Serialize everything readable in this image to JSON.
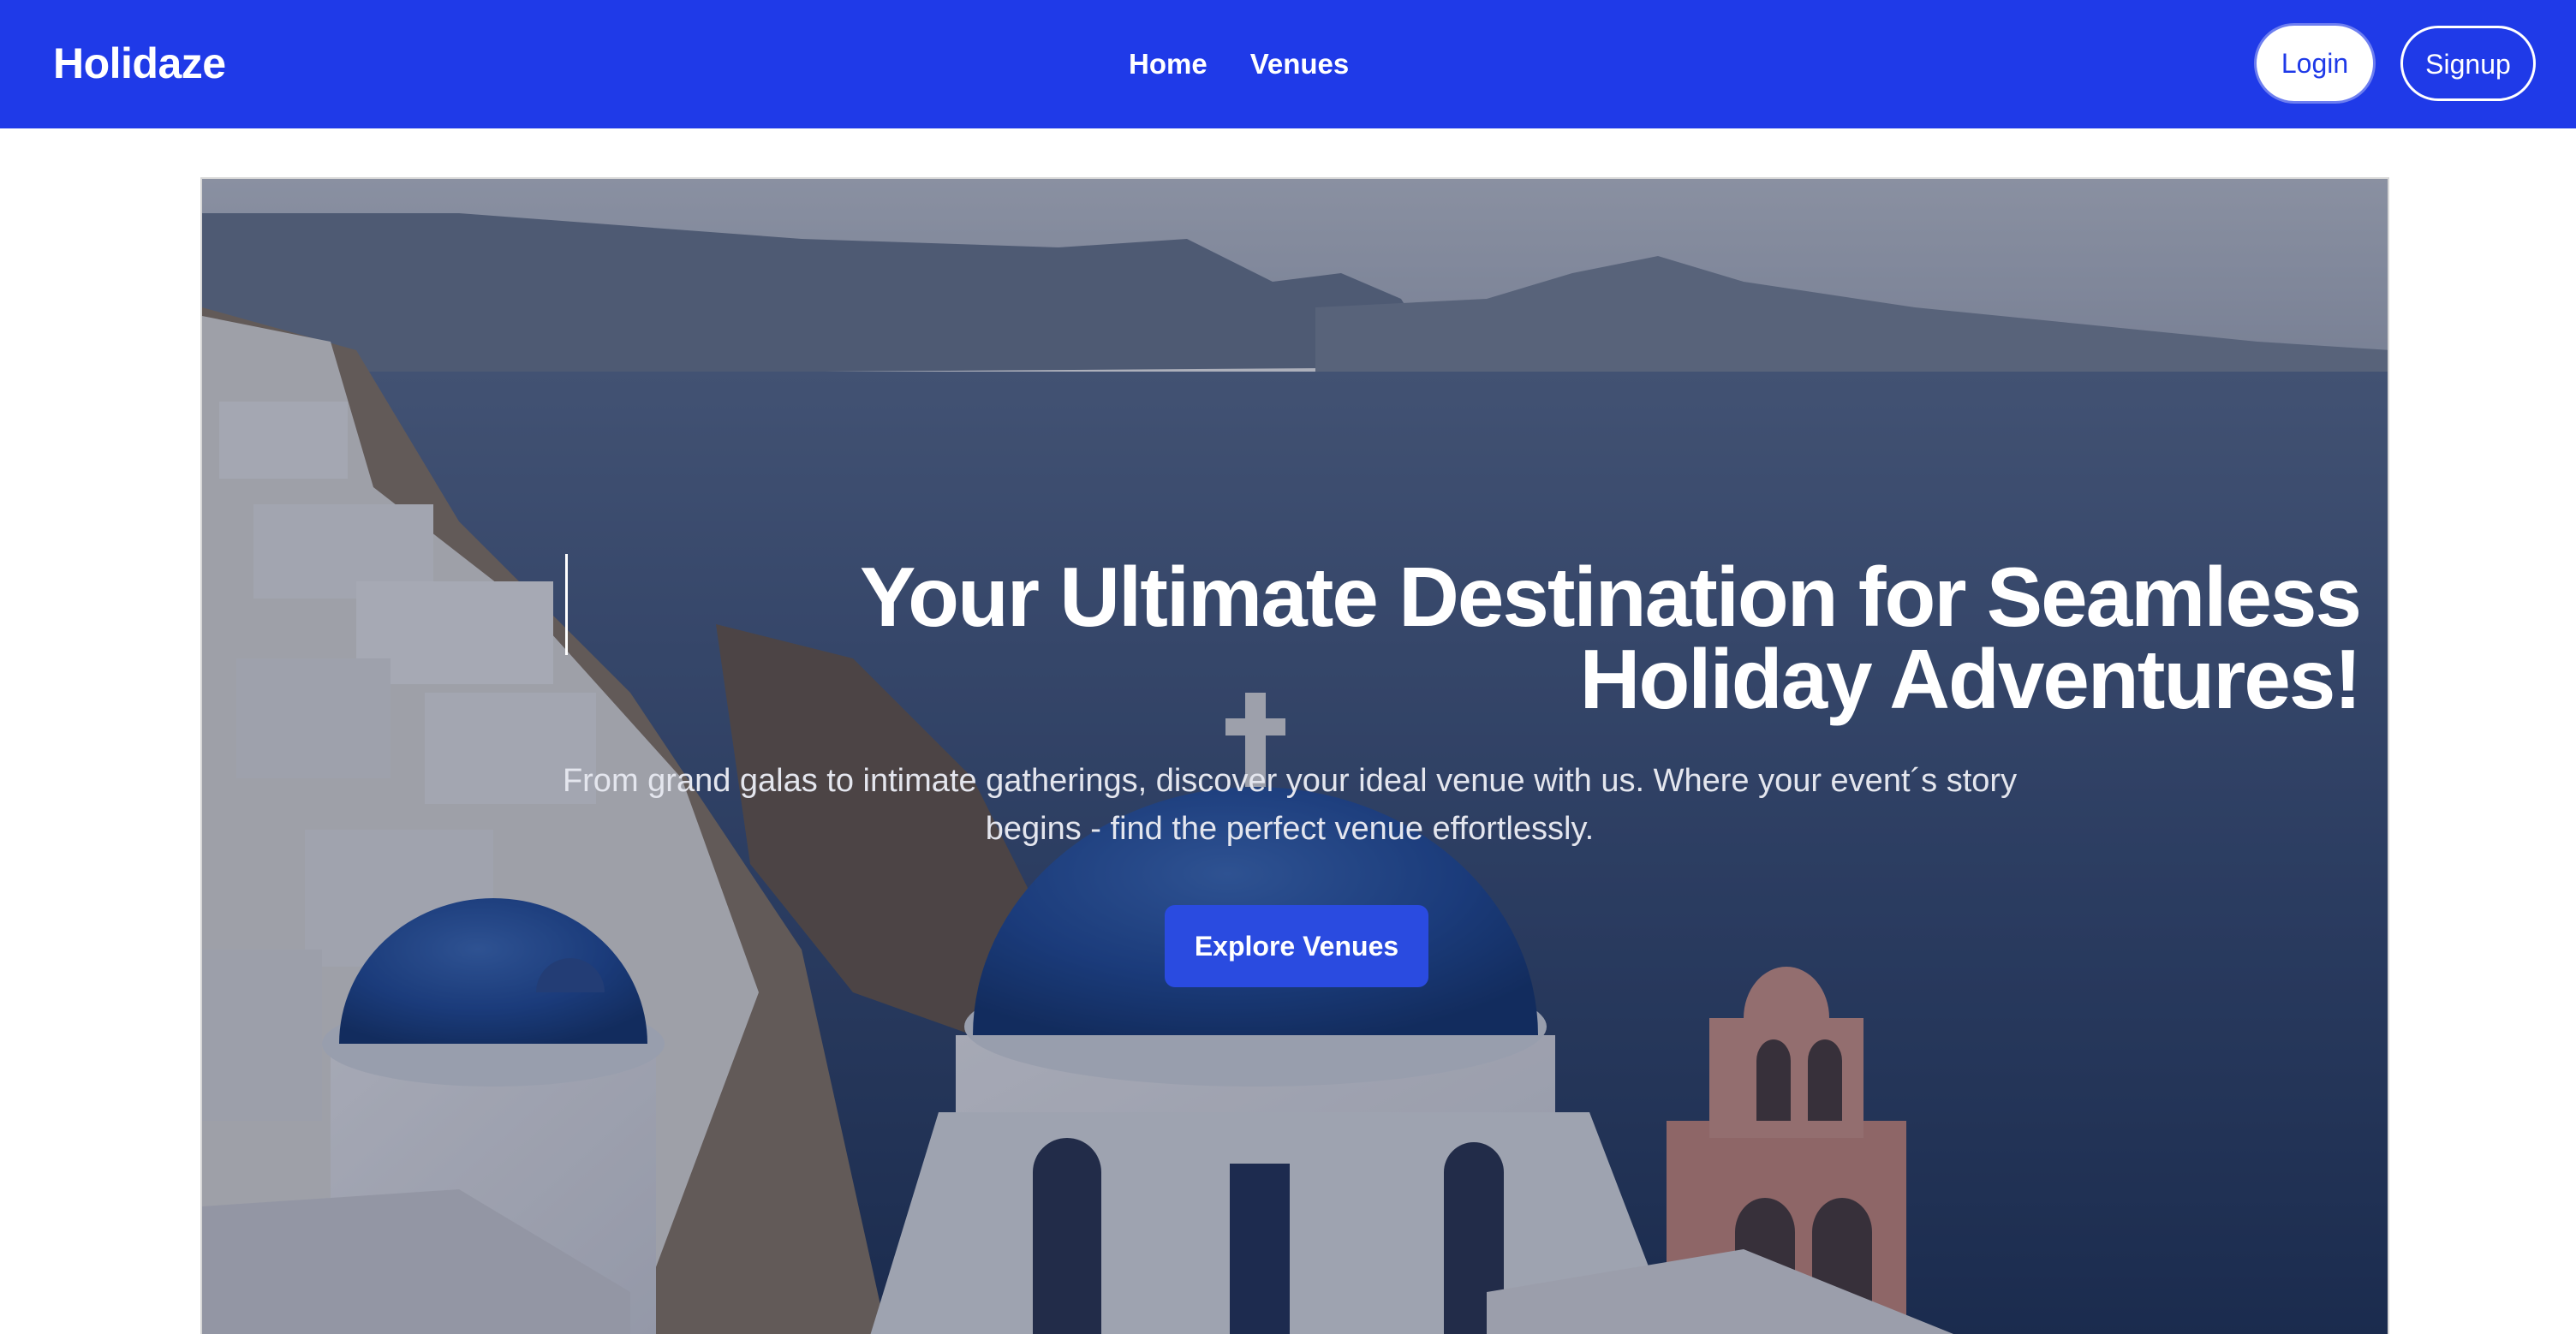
{
  "navbar": {
    "brand": "Holidaze",
    "links": [
      {
        "label": "Home"
      },
      {
        "label": "Venues"
      }
    ],
    "login_label": "Login",
    "signup_label": "Signup",
    "color": "#1f3ae8"
  },
  "hero": {
    "title": "Your Ultimate Destination for Seamless Holiday Adventures!",
    "subtitle": "From grand galas to intimate gatherings, discover your ideal venue with us. Where your event´s story begins - find the perfect venue effortlessly.",
    "cta_label": "Explore Venues",
    "cta_color": "#2a4be0",
    "background_image": "santorini-blue-domes-photo"
  }
}
